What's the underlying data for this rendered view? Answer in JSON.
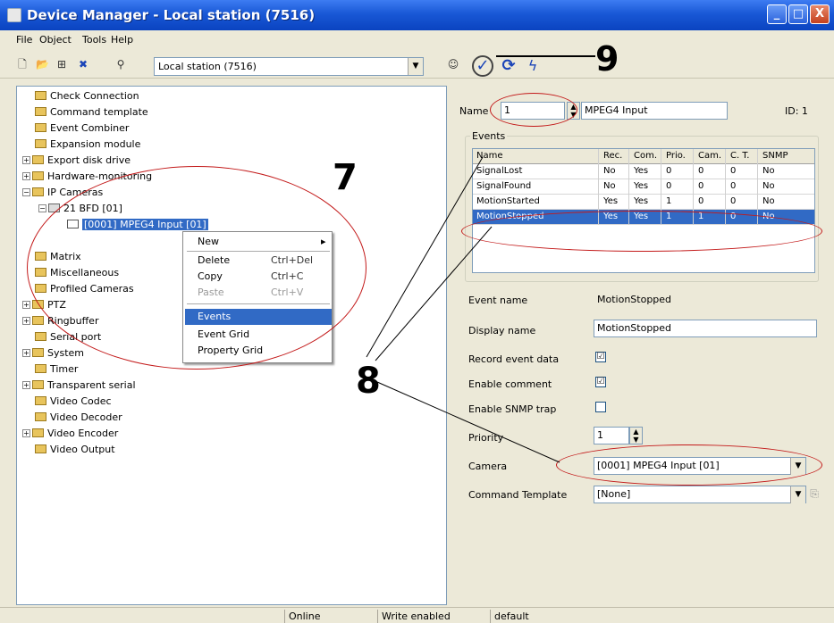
{
  "window": {
    "title": "Device Manager - Local station (7516)",
    "min_label": "_",
    "max_label": "□",
    "close_label": "X"
  },
  "menu": {
    "items": [
      "File",
      "Object",
      "Tools",
      "Help"
    ]
  },
  "toolbar": {
    "station_value": "Local station (7516)"
  },
  "annotations": {
    "seven": "7",
    "eight": "8",
    "nine": "9",
    "color": "#c31a1a"
  },
  "tree": {
    "items": [
      {
        "label": "Check Connection"
      },
      {
        "label": "Command template"
      },
      {
        "label": "Event Combiner"
      },
      {
        "label": "Expansion module"
      },
      {
        "label": "Export disk drive"
      },
      {
        "label": "Hardware-monitoring"
      },
      {
        "label": "IP Cameras"
      },
      {
        "label": "21 BFD [01]"
      },
      {
        "label": "[0001] MPEG4 Input [01]"
      },
      {
        "label": "Matrix"
      },
      {
        "label": "Miscellaneous"
      },
      {
        "label": "Profiled Cameras"
      },
      {
        "label": "PTZ"
      },
      {
        "label": "Ringbuffer"
      },
      {
        "label": "Serial port"
      },
      {
        "label": "System"
      },
      {
        "label": "Timer"
      },
      {
        "label": "Transparent serial"
      },
      {
        "label": "Video Codec"
      },
      {
        "label": "Video Decoder"
      },
      {
        "label": "Video Encoder"
      },
      {
        "label": "Video Output"
      }
    ]
  },
  "context_menu": {
    "items": [
      {
        "label": "New",
        "shortcut": ""
      },
      {
        "label": "Delete",
        "shortcut": "Ctrl+Del"
      },
      {
        "label": "Copy",
        "shortcut": "Ctrl+C"
      },
      {
        "label": "Paste",
        "shortcut": "Ctrl+V"
      },
      {
        "label": "Events",
        "shortcut": ""
      },
      {
        "label": "Event Grid",
        "shortcut": ""
      },
      {
        "label": "Property Grid",
        "shortcut": ""
      }
    ]
  },
  "details": {
    "name_label": "Name",
    "name_number": "1",
    "name_value": "MPEG4 Input",
    "id_label": "ID: 1",
    "events_label": "Events",
    "columns": [
      "Name",
      "Rec.",
      "Com.",
      "Prio.",
      "Cam.",
      "C. T.",
      "SNMP"
    ],
    "rows": [
      [
        "SignalLost",
        "No",
        "Yes",
        "0",
        "0",
        "0",
        "No"
      ],
      [
        "SignalFound",
        "No",
        "Yes",
        "0",
        "0",
        "0",
        "No"
      ],
      [
        "MotionStarted",
        "Yes",
        "Yes",
        "1",
        "0",
        "0",
        "No"
      ],
      [
        "MotionStopped",
        "Yes",
        "Yes",
        "1",
        "1",
        "0",
        "No"
      ]
    ],
    "event_name_label": "Event name",
    "event_name_value": "MotionStopped",
    "display_name_label": "Display name",
    "display_name_value": "MotionStopped",
    "record_label": "Record event data",
    "record_checked": "☑",
    "enable_comment_label": "Enable comment",
    "enable_comment_checked": "☑",
    "snmp_label": "Enable SNMP trap",
    "priority_label": "Priority",
    "priority_value": "1",
    "camera_label": "Camera",
    "camera_value": "[0001] MPEG4 Input [01]",
    "command_template_label": "Command Template",
    "command_template_value": "[None]"
  },
  "status": {
    "online": "Online",
    "write": "Write enabled",
    "profile": "default"
  }
}
